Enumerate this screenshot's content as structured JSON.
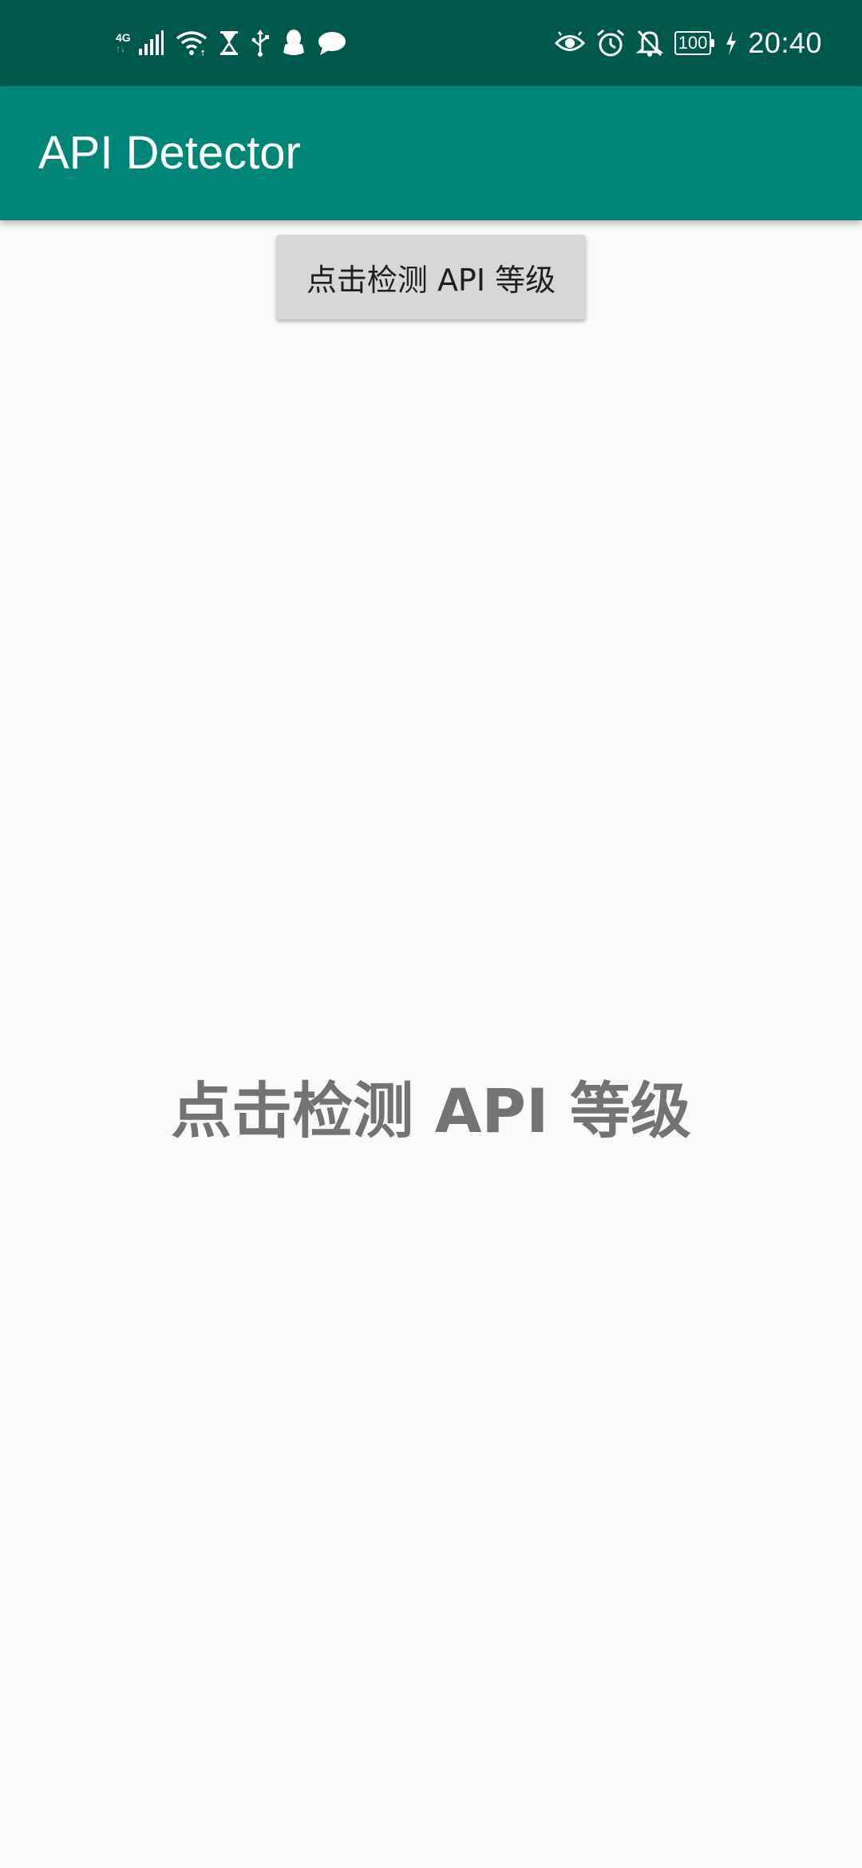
{
  "status_bar": {
    "network_type": "4G",
    "network_arrows": "↑↓",
    "battery_level": "100",
    "time": "20:40",
    "left_icons": [
      "signal-icon",
      "wifi-icon",
      "hourglass-icon",
      "usb-icon",
      "qq-icon",
      "chat-bubble-icon"
    ],
    "right_icons": [
      "eye-icon",
      "alarm-icon",
      "bell-off-icon",
      "battery-icon",
      "charging-icon"
    ]
  },
  "app_bar": {
    "title": "API Detector"
  },
  "main": {
    "detect_button_label": "点击检测 API 等级",
    "result_text": "点击检测 API 等级"
  },
  "colors": {
    "status_bar": "#00574b",
    "primary": "#008577",
    "background": "#fafafa",
    "button": "#d6d7d7",
    "result_text": "#737373"
  }
}
